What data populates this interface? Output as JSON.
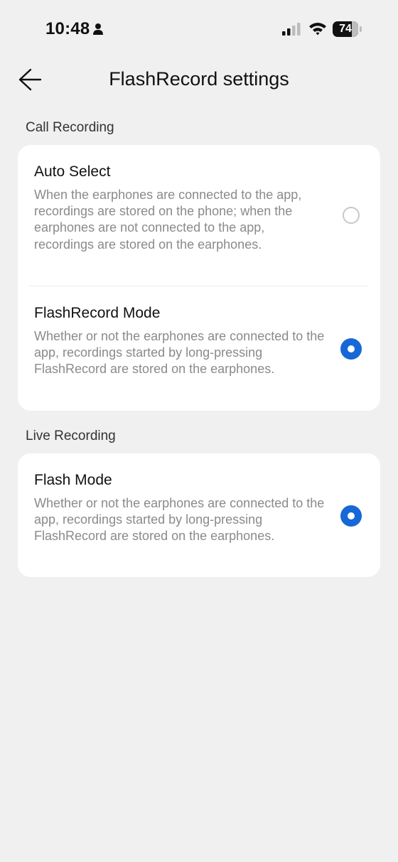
{
  "status_bar": {
    "time": "10:48",
    "battery_level": "74",
    "icons": [
      "person-icon",
      "signal-icon",
      "wifi-icon",
      "battery-icon"
    ]
  },
  "header": {
    "title": "FlashRecord settings",
    "back_icon": "arrow-left-icon"
  },
  "sections": [
    {
      "label": "Call Recording",
      "options": [
        {
          "title": "Auto Select",
          "description": "When the earphones are connected to the app, recordings are stored on the phone; when the earphones are not connected to the app, recordings are stored on the earphones.",
          "selected": false
        },
        {
          "title": "FlashRecord Mode",
          "description": "Whether or not the earphones are connected to the app, recordings started by long-pressing FlashRecord are stored on the earphones.",
          "selected": true
        }
      ]
    },
    {
      "label": "Live Recording",
      "options": [
        {
          "title": "Flash Mode",
          "description": "Whether or not the earphones are connected to the app, recordings started by long-pressing FlashRecord are stored on the earphones.",
          "selected": true
        }
      ]
    }
  ],
  "colors": {
    "background": "#f0f0f0",
    "card": "#ffffff",
    "accent": "#1668d6",
    "description": "#8a8a8a"
  }
}
